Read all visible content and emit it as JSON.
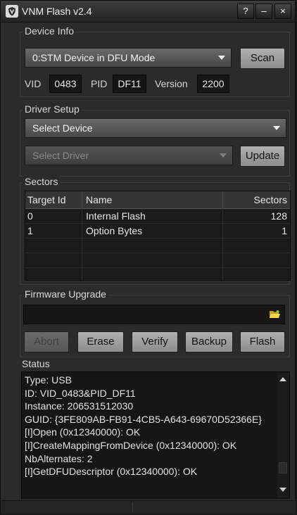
{
  "window": {
    "title": "VNM Flash v2.4",
    "icon": "shield-logo-icon",
    "controls": {
      "help": "?",
      "minimize": "–",
      "close": "×"
    }
  },
  "device_info": {
    "group_label": "Device Info",
    "device_selected": "0:STM Device in DFU Mode",
    "scan_label": "Scan",
    "vid_label": "VID",
    "vid_value": "0483",
    "pid_label": "PID",
    "pid_value": "DF11",
    "version_label": "Version",
    "version_value": "2200"
  },
  "driver_setup": {
    "group_label": "Driver Setup",
    "device_placeholder": "Select Device",
    "driver_placeholder": "Select Driver",
    "update_label": "Update"
  },
  "sectors": {
    "group_label": "Sectors",
    "columns": [
      "Target Id",
      "Name",
      "Sectors"
    ],
    "rows": [
      {
        "target_id": "0",
        "name": "Internal Flash",
        "sectors": "128"
      },
      {
        "target_id": "1",
        "name": "Option Bytes",
        "sectors": "1"
      }
    ]
  },
  "firmware": {
    "group_label": "Firmware Upgrade",
    "path_value": "",
    "browse_icon": "folder-open-icon",
    "buttons": {
      "abort": "Abort",
      "erase": "Erase",
      "verify": "Verify",
      "backup": "Backup",
      "flash": "Flash"
    }
  },
  "status": {
    "group_label": "Status",
    "lines": [
      "Type: USB",
      "ID: VID_0483&PID_DF11",
      "Instance: 206531512030",
      "GUID: {3FE809AB-FB91-4CB5-A643-69670D52366E}",
      "[I]Open (0x12340000): OK",
      "[I]CreateMappingFromDevice (0x12340000): OK",
      "NbAlternates: 2",
      "[I]GetDFUDescriptor (0x12340000): OK"
    ]
  },
  "colors": {
    "window_bg": "#2b2b2b",
    "titlebar": "#2f2f2f",
    "button_face": "#9e9e9e",
    "field_bg": "#161616",
    "text": "#e6e6e6",
    "folder_icon": "#e8c93a"
  }
}
